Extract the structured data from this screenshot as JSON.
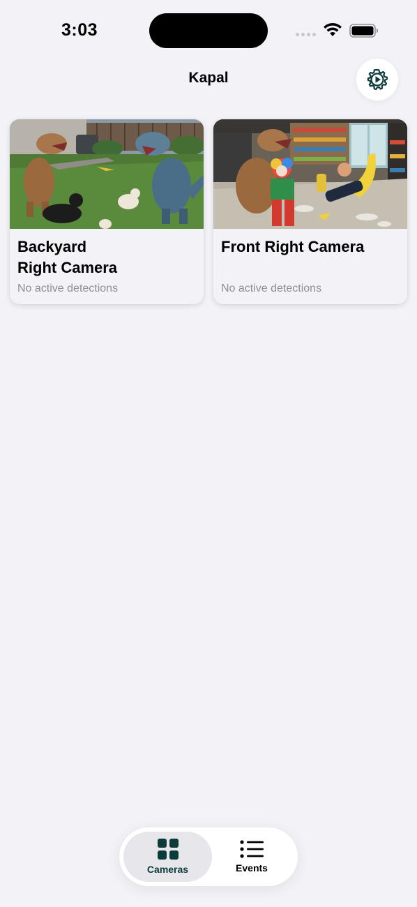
{
  "status_bar": {
    "time": "3:03"
  },
  "header": {
    "title": "Kapal",
    "settings_icon": "gear-play-icon"
  },
  "cameras": [
    {
      "name": "Backyard\nRight Camera",
      "status": "No active detections",
      "thumbnail": "backyard scene"
    },
    {
      "name": "Front Right Camera",
      "status": "No active detections",
      "thumbnail": "convenience store scene"
    }
  ],
  "tab_bar": {
    "tabs": [
      {
        "label": "Cameras",
        "icon": "grid-icon",
        "selected": true
      },
      {
        "label": "Events",
        "icon": "list-icon",
        "selected": false
      }
    ]
  },
  "colors": {
    "background": "#f2f2f7",
    "accent": "#0b3b3b",
    "secondary_text": "#8e8e93"
  }
}
